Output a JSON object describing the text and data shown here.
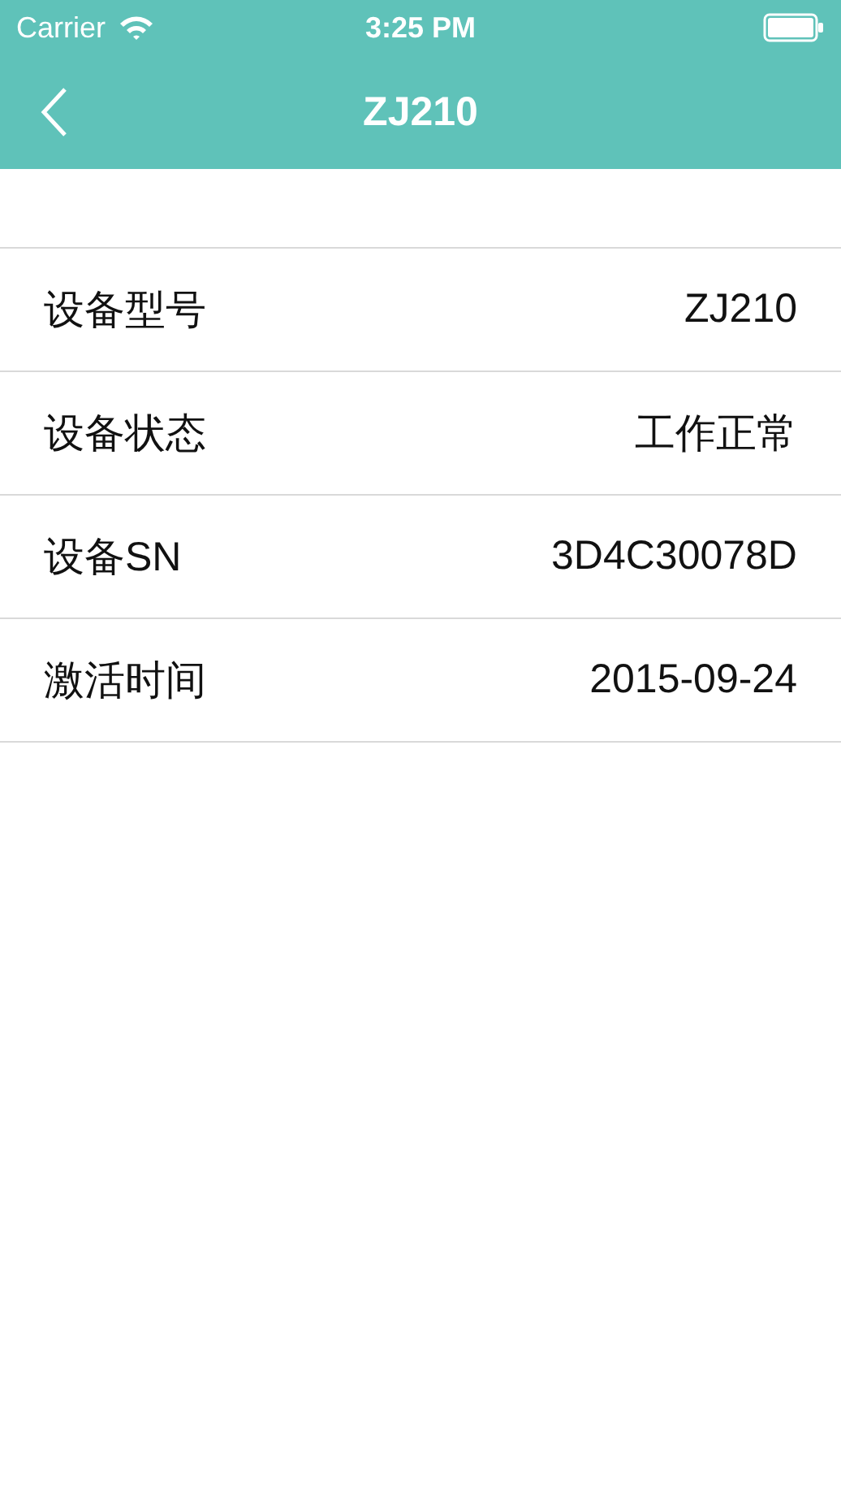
{
  "status_bar": {
    "carrier": "Carrier",
    "time": "3:25 PM"
  },
  "nav_bar": {
    "title": "ZJ210"
  },
  "rows": [
    {
      "label": "设备型号",
      "value": "ZJ210"
    },
    {
      "label": "设备状态",
      "value": "工作正常"
    },
    {
      "label": "设备SN",
      "value": "3D4C30078D"
    },
    {
      "label": "激活时间",
      "value": "2015-09-24"
    }
  ]
}
